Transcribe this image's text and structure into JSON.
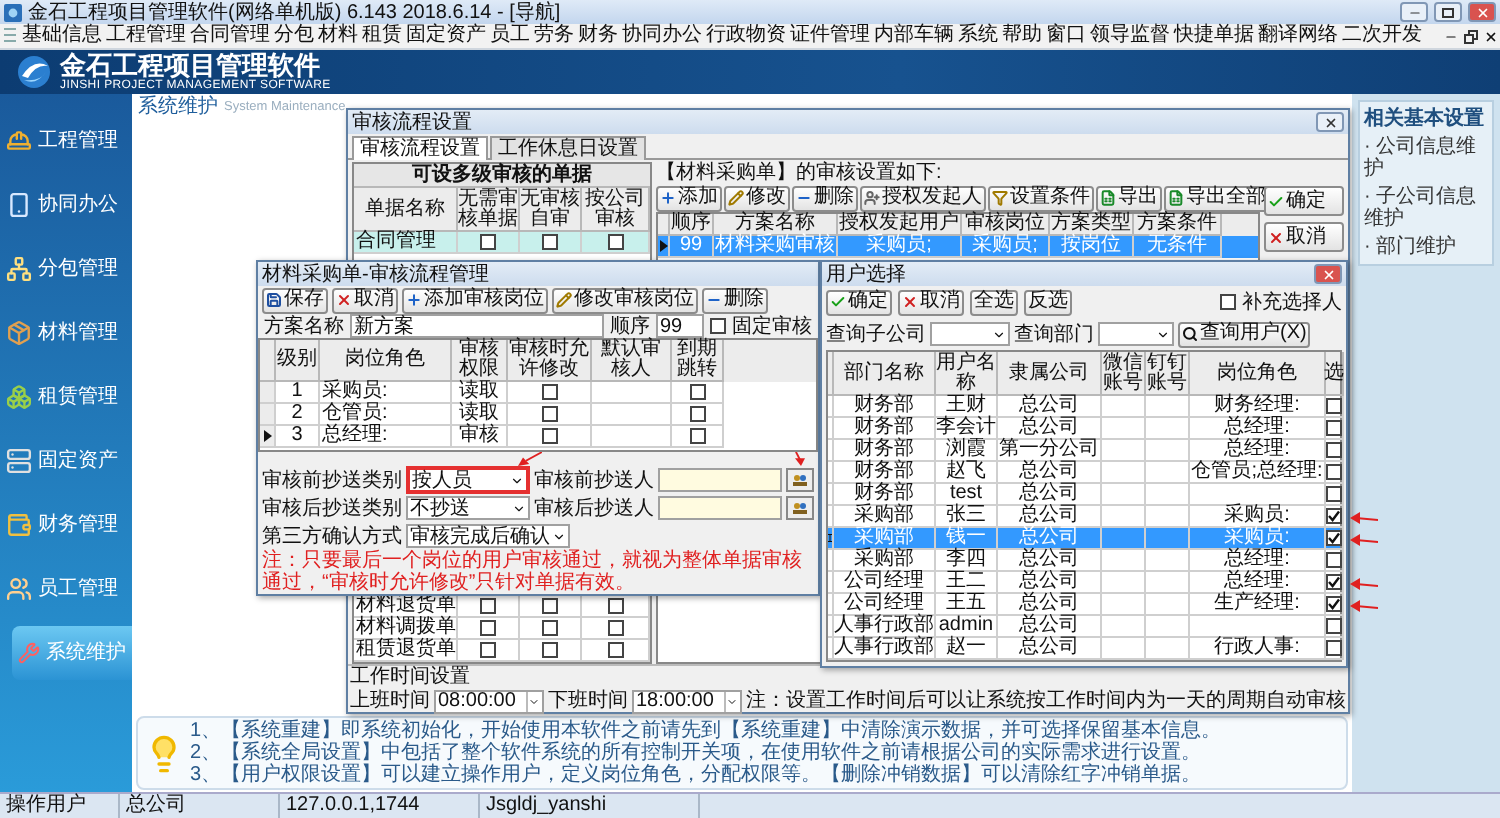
{
  "window": {
    "title": "金石工程项目管理软件(网络单机版) 6.143  2018.6.14 - [导航]"
  },
  "menu": [
    "基础信息",
    "工程管理",
    "合同管理",
    "分包",
    "材料",
    "租赁",
    "固定资产",
    "员工",
    "劳务",
    "财务",
    "协同办公",
    "行政物资",
    "证件管理",
    "内部车辆",
    "系统",
    "帮助",
    "窗口",
    "领导监督",
    "快捷单据",
    "翻译网络",
    "二次开发"
  ],
  "banner": {
    "title": "金石工程项目管理软件",
    "subtitle": "JINSHI PROJECT MANAGEMENT SOFTWARE"
  },
  "sidebar": {
    "items": [
      {
        "label": "工程管理",
        "selected": false
      },
      {
        "label": "协同办公",
        "selected": false
      },
      {
        "label": "分包管理",
        "selected": false
      },
      {
        "label": "材料管理",
        "selected": false
      },
      {
        "label": "租赁管理",
        "selected": false
      },
      {
        "label": "固定资产",
        "selected": false
      },
      {
        "label": "财务管理",
        "selected": false
      },
      {
        "label": "员工管理",
        "selected": false
      },
      {
        "label": "系统维护",
        "selected": true
      }
    ]
  },
  "page": {
    "title": "系统维护",
    "subtitle": "System Maintenance"
  },
  "audit_dialog": {
    "title": "审核流程设置",
    "tabs": [
      {
        "label": "审核流程设置",
        "selected": true
      },
      {
        "label": "工作休息日设置",
        "selected": false
      }
    ],
    "forms": {
      "title": "可设多级审核的单据",
      "columns": [
        "单据名称",
        "无需审核单据",
        "无审核自审",
        "按公司审核"
      ],
      "top_rows": [
        {
          "name": "合同管理",
          "checks": [
            false,
            false,
            false
          ],
          "selected": true
        }
      ],
      "bottom_rows": [
        {
          "name": "材料退货单",
          "checks": [
            false,
            false,
            false
          ],
          "selected": false
        },
        {
          "name": "材料调拨单",
          "checks": [
            false,
            false,
            false
          ],
          "selected": false
        },
        {
          "name": "租赁退货单",
          "checks": [
            false,
            false,
            false
          ],
          "selected": false
        }
      ]
    },
    "plans": {
      "heading": "【材料采购单】的审核设置如下:",
      "toolbar": [
        {
          "label": "添加",
          "kind": "add"
        },
        {
          "label": "修改",
          "kind": "edit"
        },
        {
          "label": "删除",
          "kind": "delete"
        },
        {
          "label": "授权发起人",
          "kind": "authorize"
        },
        {
          "label": "设置条件",
          "kind": "condition"
        },
        {
          "label": "导出",
          "kind": "export"
        },
        {
          "label": "导出全部",
          "kind": "export"
        }
      ],
      "columns": [
        "顺序",
        "方案名称",
        "授权发起用户",
        "审核岗位",
        "方案类型",
        "方案条件"
      ],
      "rows": [
        {
          "cells": [
            "99",
            "材料采购审核",
            "采购员;",
            "采购员;",
            "按岗位",
            "无条件"
          ],
          "selected": true
        }
      ]
    },
    "buttons": [
      {
        "label": "确定",
        "kind": "ok"
      },
      {
        "label": "取消",
        "kind": "cancel"
      }
    ],
    "work_time": {
      "title": "工作时间设置",
      "start_label": "上班时间",
      "start": "08:00:00",
      "end_label": "下班时间",
      "end": "18:00:00",
      "note": "注：设置工作时间后可以让系统按工作时间内为一天的周期自动审核"
    }
  },
  "flow_dialog": {
    "title": "材料采购单-审核流程管理",
    "toolbar": [
      {
        "label": "保存",
        "kind": "save"
      },
      {
        "label": "取消",
        "kind": "cancel"
      },
      {
        "label": "添加审核岗位",
        "kind": "add"
      },
      {
        "label": "修改审核岗位",
        "kind": "edit"
      },
      {
        "label": "删除",
        "kind": "delete"
      }
    ],
    "plan_name_label": "方案名称",
    "plan_name": "新方案",
    "order_label": "顺序",
    "order": "99",
    "fixed_check": {
      "label": "固定审核",
      "checked": false
    },
    "columns": [
      "级别",
      "岗位角色",
      "审核权限",
      "审核时允许修改",
      "默认审核人",
      "到期跳转"
    ],
    "rows": [
      {
        "level": "1",
        "role": "采购员:",
        "permission": "读取",
        "allow_edit": false,
        "jump": false,
        "selected": false
      },
      {
        "level": "2",
        "role": "仓管员:",
        "permission": "读取",
        "allow_edit": false,
        "jump": false,
        "selected": false
      },
      {
        "level": "3",
        "role": "总经理:",
        "permission": "审核",
        "allow_edit": false,
        "jump": false,
        "selected": true
      }
    ],
    "copy_rows": [
      {
        "label": "审核前抄送类别",
        "value": "按人员",
        "highlighted": true,
        "marked": true,
        "person_label": "审核前抄送人",
        "person_marked": true
      },
      {
        "label": "审核后抄送类别",
        "value": "不抄送",
        "highlighted": false,
        "marked": false,
        "person_label": "审核后抄送人",
        "person_marked": false
      }
    ],
    "confirm": {
      "label": "第三方确认方式",
      "value": "审核完成后确认"
    },
    "note": "注：只要最后一个岗位的用户审核通过，就视为整体单据审核通过，“审核时允许修改”只针对单据有效。"
  },
  "user_dialog": {
    "title": "用户选择",
    "toolbar": [
      {
        "label": "确定",
        "kind": "ok"
      },
      {
        "label": "取消",
        "kind": "cancel"
      },
      {
        "label": "全选",
        "kind": "plain"
      },
      {
        "label": "反选",
        "kind": "plain"
      }
    ],
    "extra_check": {
      "label": "补充选择人",
      "checked": false
    },
    "company_label": "查询子公司",
    "dept_label": "查询部门",
    "search_button": "查询用户(X)",
    "columns": [
      "部门名称",
      "用户名称",
      "隶属公司",
      "微信账号",
      "钉钉账号",
      "岗位角色",
      "选"
    ],
    "rows": [
      {
        "dept": "财务部",
        "user": "王财",
        "company": "总公司",
        "role": "财务经理:",
        "checked": false,
        "selected": false,
        "marked": false
      },
      {
        "dept": "财务部",
        "user": "李会计",
        "company": "总公司",
        "role": "总经理:",
        "checked": false,
        "selected": false,
        "marked": false
      },
      {
        "dept": "财务部",
        "user": "浏霞",
        "company": "第一分公司",
        "role": "总经理:",
        "checked": false,
        "selected": false,
        "marked": false
      },
      {
        "dept": "财务部",
        "user": "赵飞",
        "company": "总公司",
        "role": "仓管员;总经理:",
        "checked": false,
        "selected": false,
        "marked": false
      },
      {
        "dept": "财务部",
        "user": "test",
        "company": "总公司",
        "checked": false,
        "selected": false,
        "marked": false
      },
      {
        "dept": "采购部",
        "user": "张三",
        "company": "总公司",
        "role": "采购员:",
        "checked": true,
        "selected": false,
        "marked": true
      },
      {
        "dept": "采购部",
        "user": "钱一",
        "company": "总公司",
        "role": "采购员:",
        "checked": true,
        "selected": true,
        "marked": true
      },
      {
        "dept": "采购部",
        "user": "李四",
        "company": "总公司",
        "role": "总经理:",
        "checked": false,
        "selected": false,
        "marked": false
      },
      {
        "dept": "公司经理",
        "user": "王二",
        "company": "总公司",
        "role": "总经理:",
        "checked": true,
        "selected": false,
        "marked": true
      },
      {
        "dept": "公司经理",
        "user": "王五",
        "company": "总公司",
        "role": "生产经理:",
        "checked": true,
        "selected": false,
        "marked": true
      },
      {
        "dept": "人事行政部",
        "user": "admin",
        "company": "总公司",
        "checked": false,
        "selected": false,
        "marked": false
      },
      {
        "dept": "人事行政部",
        "user": "赵一",
        "company": "总公司",
        "role": "行政人事:",
        "checked": false,
        "selected": false,
        "marked": false
      }
    ]
  },
  "related": {
    "title": "相关基本设置",
    "items": [
      "· 公司信息维护",
      "· 子公司信息维护",
      "· 部门维护"
    ]
  },
  "tips": [
    "1、【系统重建】即系统初始化，开始使用本软件之前请先到【系统重建】中清除演示数据，并可选择保留基本信息。",
    "2、【系统全局设置】中包括了整个软件系统的所有控制开关项，在使用软件之前请根据公司的实际需求进行设置。",
    "3、【用户权限设置】可以建立操作用户，定义岗位角色，分配权限等。【删除冲销数据】可以清除红字冲销单据。"
  ],
  "status_bar": [
    "操作用户",
    "总公司",
    "127.0.0.1,1744",
    "Jsgldj_yanshi"
  ]
}
